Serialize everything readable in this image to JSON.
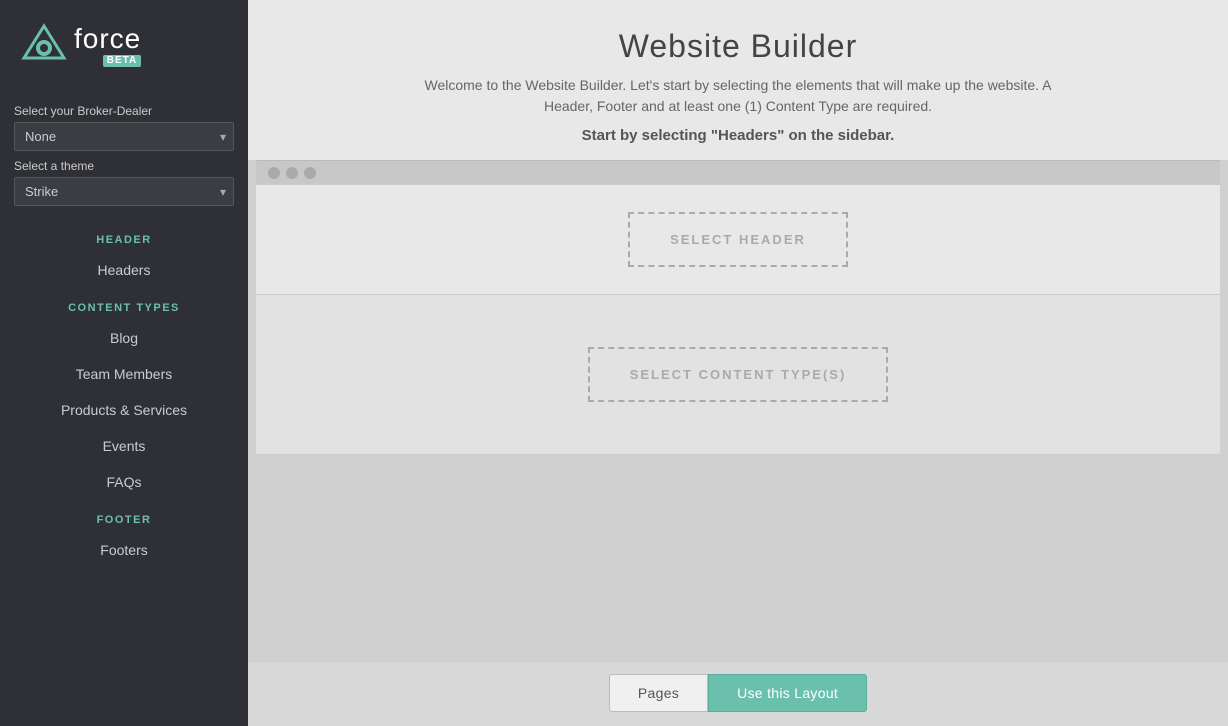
{
  "app": {
    "name": "force",
    "badge": "BETA"
  },
  "sidebar": {
    "broker_dealer_label": "Select your Broker-Dealer",
    "broker_dealer_value": "None",
    "theme_label": "Select a theme",
    "theme_value": "Strike",
    "broker_dealer_options": [
      "None"
    ],
    "theme_options": [
      "Strike"
    ],
    "sections": [
      {
        "title": "HEADER",
        "items": [
          "Headers"
        ]
      },
      {
        "title": "CONTENT TYPES",
        "items": [
          "Blog",
          "Team Members",
          "Products & Services",
          "Events",
          "FAQs"
        ]
      },
      {
        "title": "FOOTER",
        "items": [
          "Footers"
        ]
      }
    ]
  },
  "main": {
    "title": "Website Builder",
    "subtitle": "Welcome to the Website Builder. Let's start by selecting the elements that will make up the website. A Header, Footer and at least one (1) Content Type are required.",
    "cta": "Start by selecting \"Headers\" on the sidebar.",
    "header_zone_label": "SELECT HEADER",
    "content_zone_label": "SELECT CONTENT TYPE(S)"
  },
  "bottom_bar": {
    "pages_label": "Pages",
    "use_layout_label": "Use this Layout"
  }
}
